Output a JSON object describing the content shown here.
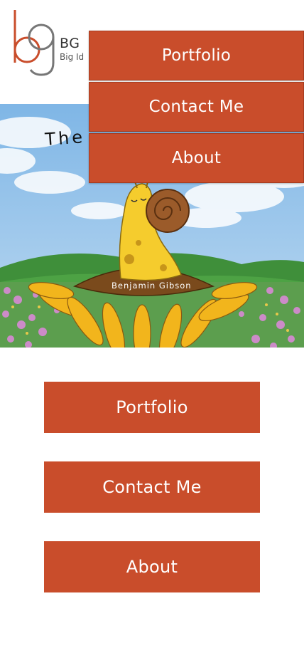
{
  "brand": {
    "logo_icon": "bg-monogram-logo",
    "name": "BG",
    "tagline": "Big Id",
    "colors": {
      "accent": "#c94d2b",
      "logo_b": "#c94d2b",
      "logo_g": "#777777"
    }
  },
  "hero": {
    "title_text": "The",
    "signature": "Benjamin Gibson",
    "image": "snail-on-sunflower-illustration"
  },
  "dropdown": {
    "items": [
      {
        "label": "Portfolio"
      },
      {
        "label": "Contact Me"
      },
      {
        "label": "About"
      }
    ]
  },
  "main_buttons": {
    "items": [
      {
        "label": "Portfolio"
      },
      {
        "label": "Contact Me"
      },
      {
        "label": "About"
      }
    ]
  }
}
